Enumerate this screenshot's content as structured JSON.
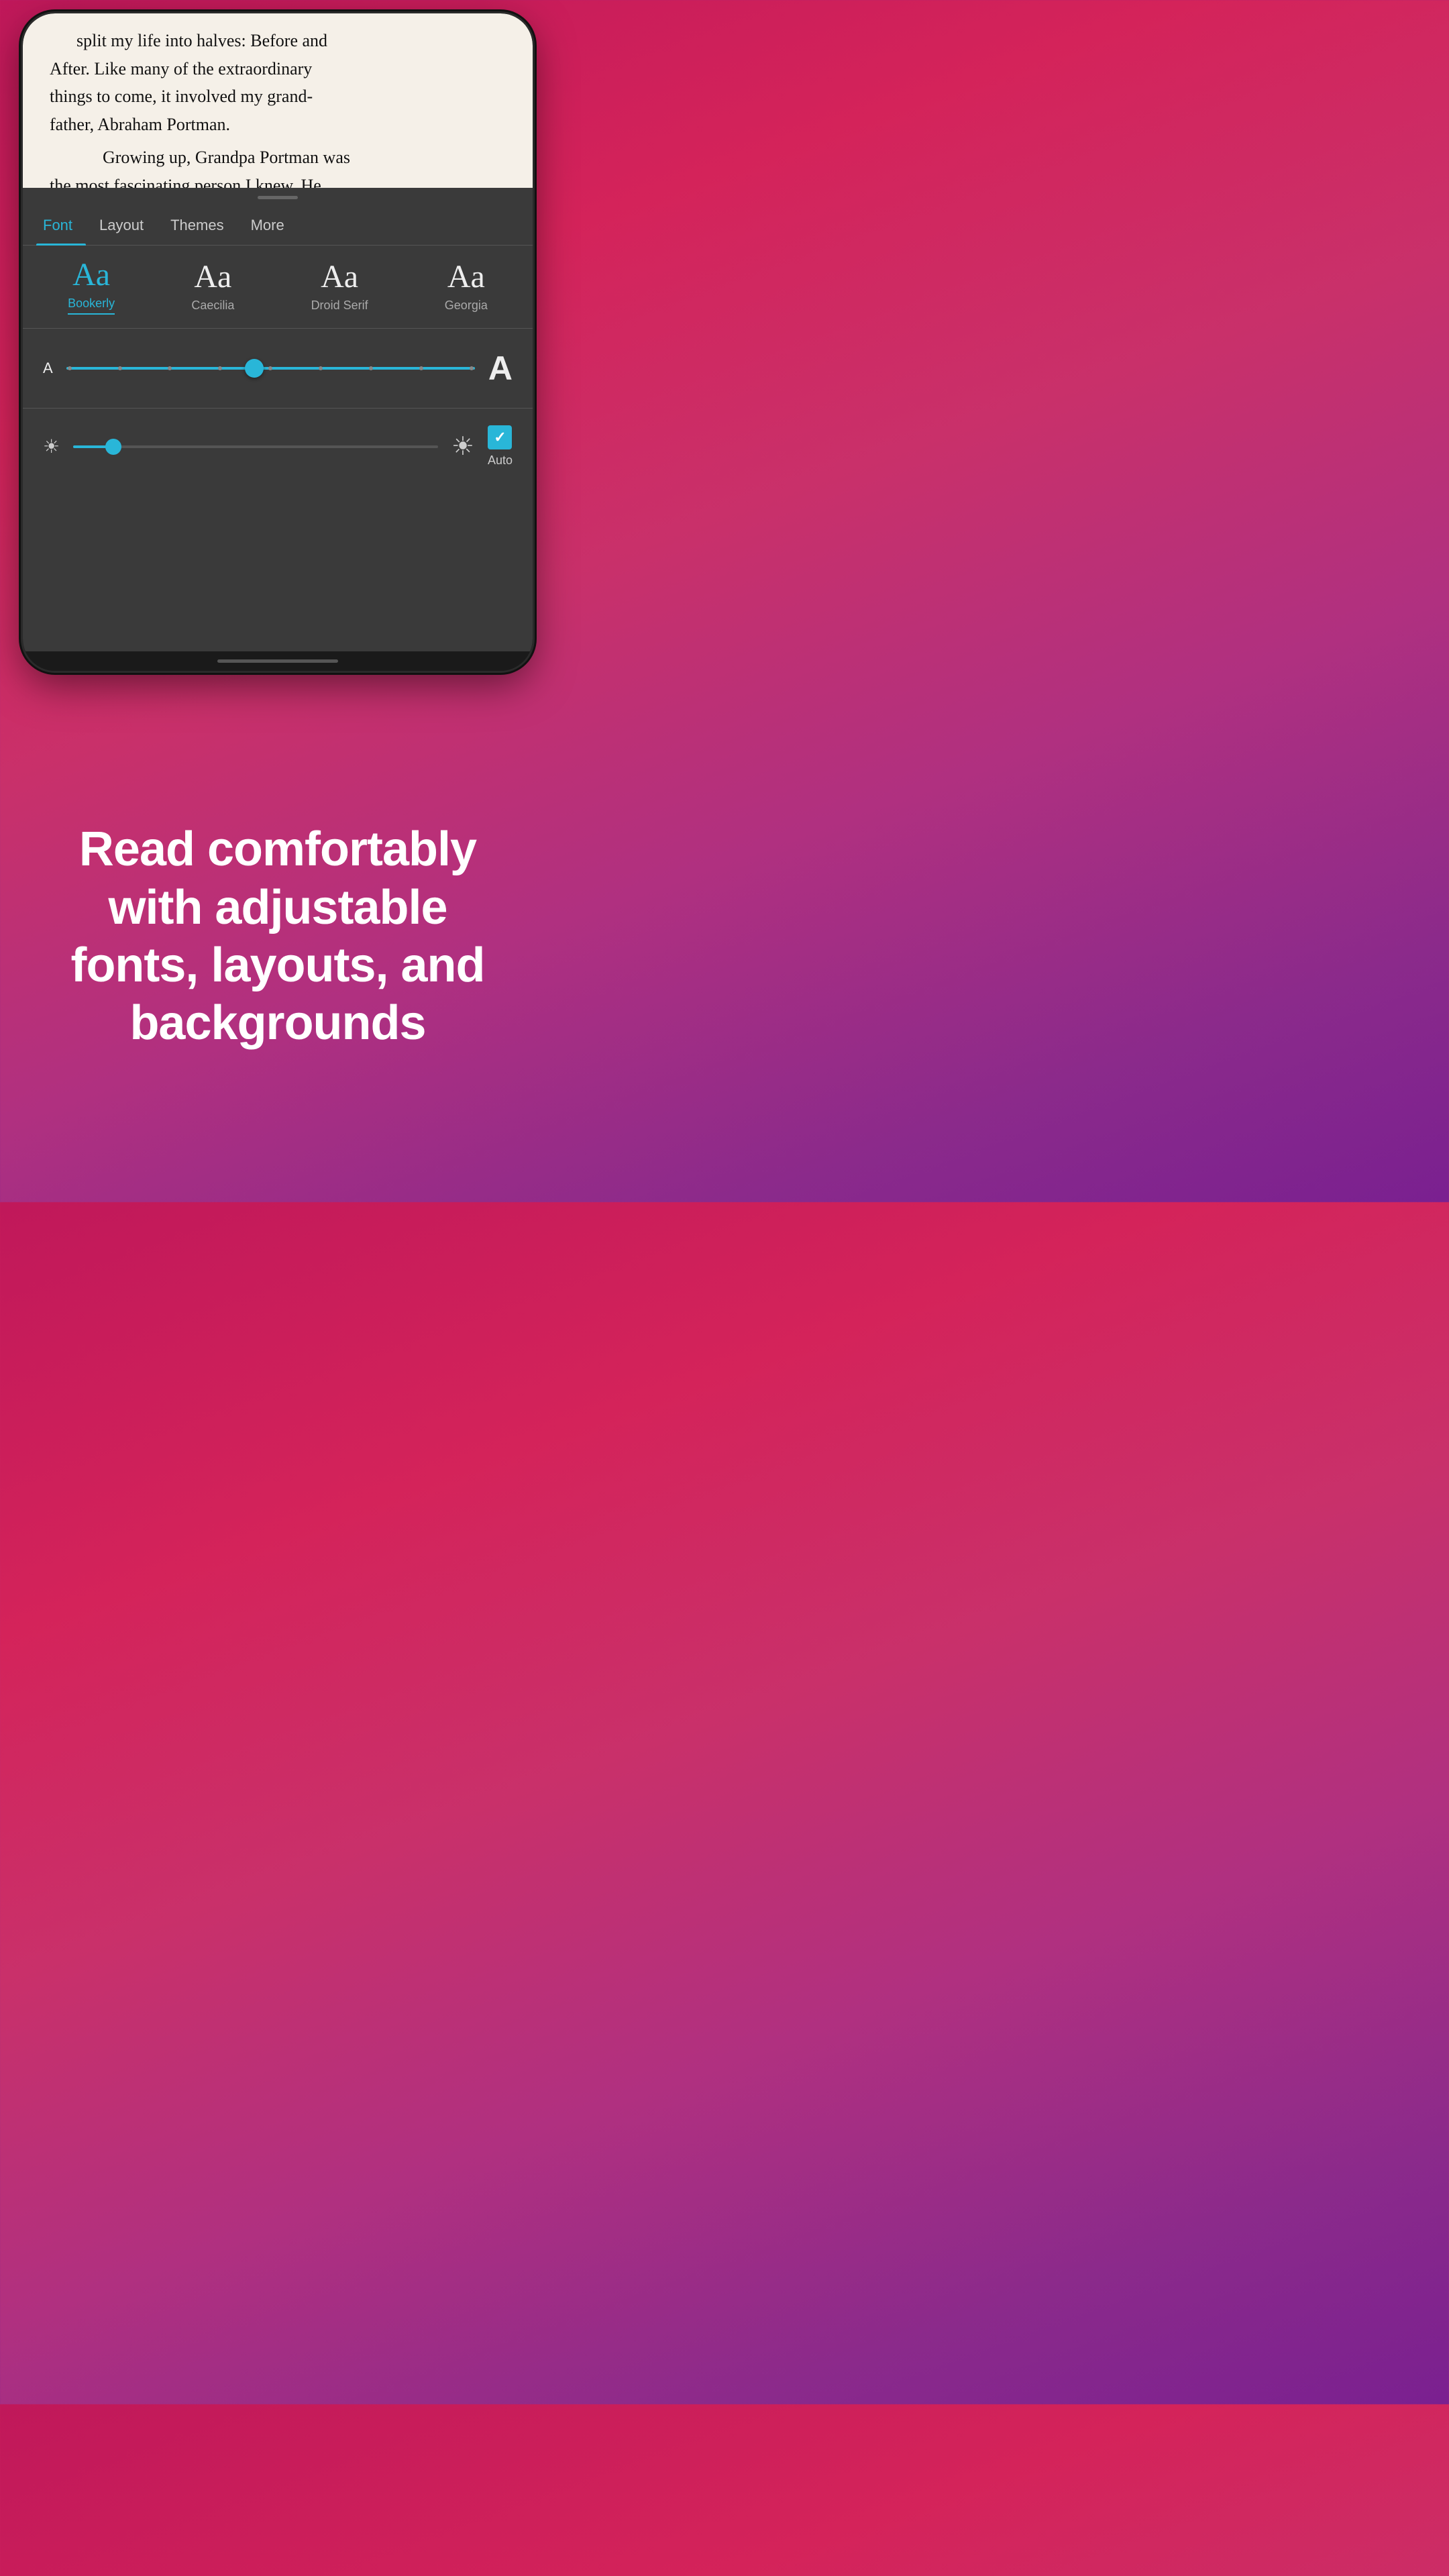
{
  "phone": {
    "book": {
      "text_line1": "split my life into halves: Before and",
      "text_line2": "After. Like many of the extraordinary",
      "text_line3": "things to come, it involved my grand-",
      "text_line4": "father, Abraham Portman.",
      "text_line5": "Growing up, Grandpa Portman was",
      "text_line6": "the most fascinating person I knew. He"
    },
    "tabs": [
      {
        "id": "font",
        "label": "Font",
        "active": true
      },
      {
        "id": "layout",
        "label": "Layout",
        "active": false
      },
      {
        "id": "themes",
        "label": "Themes",
        "active": false
      },
      {
        "id": "more",
        "label": "More",
        "active": false
      }
    ],
    "fonts": [
      {
        "id": "bookerly",
        "preview": "Aa",
        "name": "Bookerly",
        "selected": true
      },
      {
        "id": "caecilia",
        "preview": "Aa",
        "name": "Caecilia",
        "selected": false
      },
      {
        "id": "droid-serif",
        "preview": "Aa",
        "name": "Droid Serif",
        "selected": false
      },
      {
        "id": "georgia",
        "preview": "Aa",
        "name": "Georgia",
        "selected": false
      }
    ],
    "font_size": {
      "small_label": "A",
      "large_label": "A",
      "slider_value": 46
    },
    "brightness": {
      "slider_value": 11,
      "auto_label": "Auto",
      "auto_checked": true
    }
  },
  "marketing": {
    "headline": "Read comfortably with adjustable fonts, layouts, and backgrounds"
  },
  "colors": {
    "accent": "#29b6d8",
    "panel_bg": "#3a3a3a",
    "active_tab": "#29b6d8",
    "text_light": "#eee",
    "text_muted": "#aaa",
    "gradient_start": "#c0185a",
    "gradient_end": "#7a2090"
  }
}
